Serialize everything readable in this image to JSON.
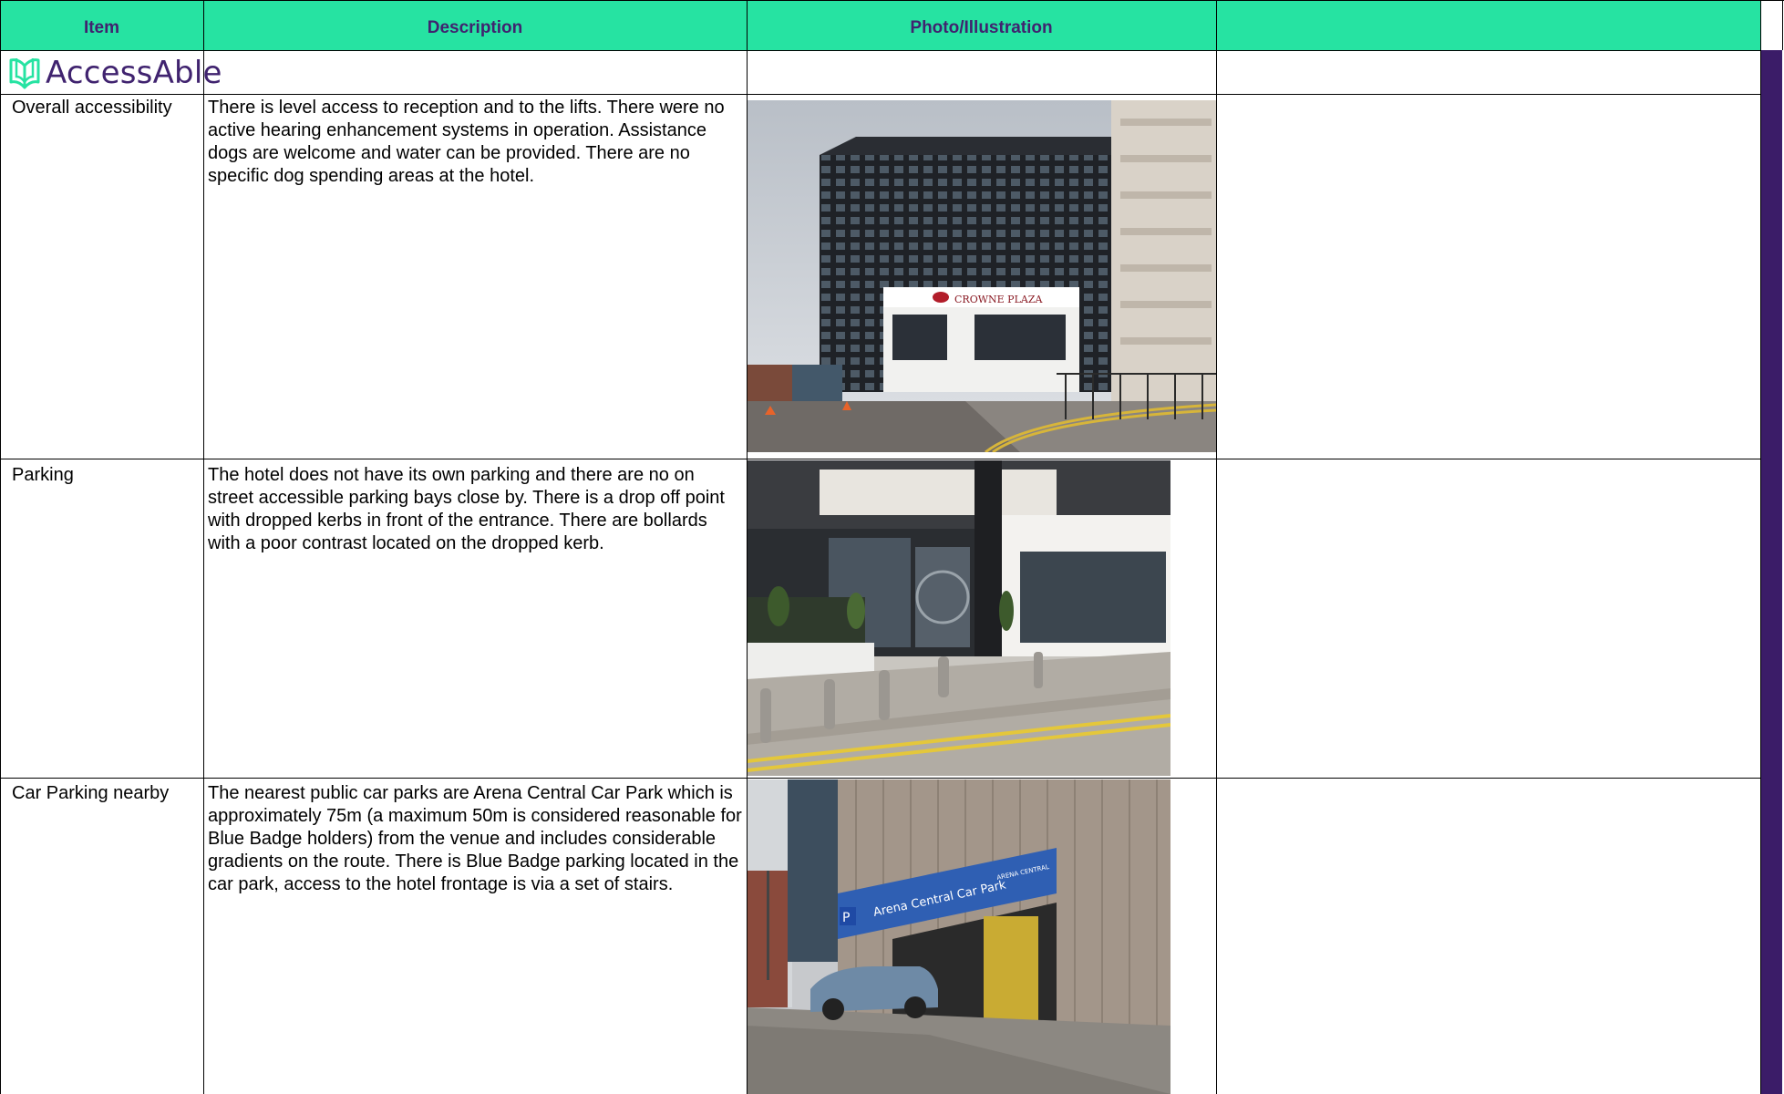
{
  "columns": {
    "item": "Item",
    "description": "Description",
    "photo": "Photo/Illustration",
    "extra": ""
  },
  "logo": {
    "text": "AccessAble",
    "icon": "accessable-book-icon"
  },
  "rows": [
    {
      "item": "Overall accessibility",
      "description": "There is level access to reception and to the lifts. There were no active hearing enhancement systems in operation. Assistance dogs are welcome and water can be provided. There are no specific dog spending areas at the hotel.",
      "photo_sign": "CROWNE PLAZA"
    },
    {
      "item": "Parking",
      "description": "The hotel does not have its own parking and there are no on street accessible parking bays close by. There is a drop off point with dropped kerbs in front of the entrance. There are bollards with a poor contrast located on the dropped kerb."
    },
    {
      "item": "Car Parking nearby",
      "description": "The nearest public car parks are Arena Central Car Park which is approximately 75m (a maximum 50m is considered reasonable for Blue Badge holders) from the venue and includes considerable gradients on the route. There is Blue Badge parking located in the car park, access to the hotel frontage is via a set of stairs.",
      "photo_sign": "Arena Central Car Park",
      "photo_sign2": "ARENA CENTRAL",
      "photo_p": "P"
    }
  ],
  "colors": {
    "header_bg": "#26e3a2",
    "header_text": "#40236f",
    "accent_bar": "#3b1c68"
  }
}
